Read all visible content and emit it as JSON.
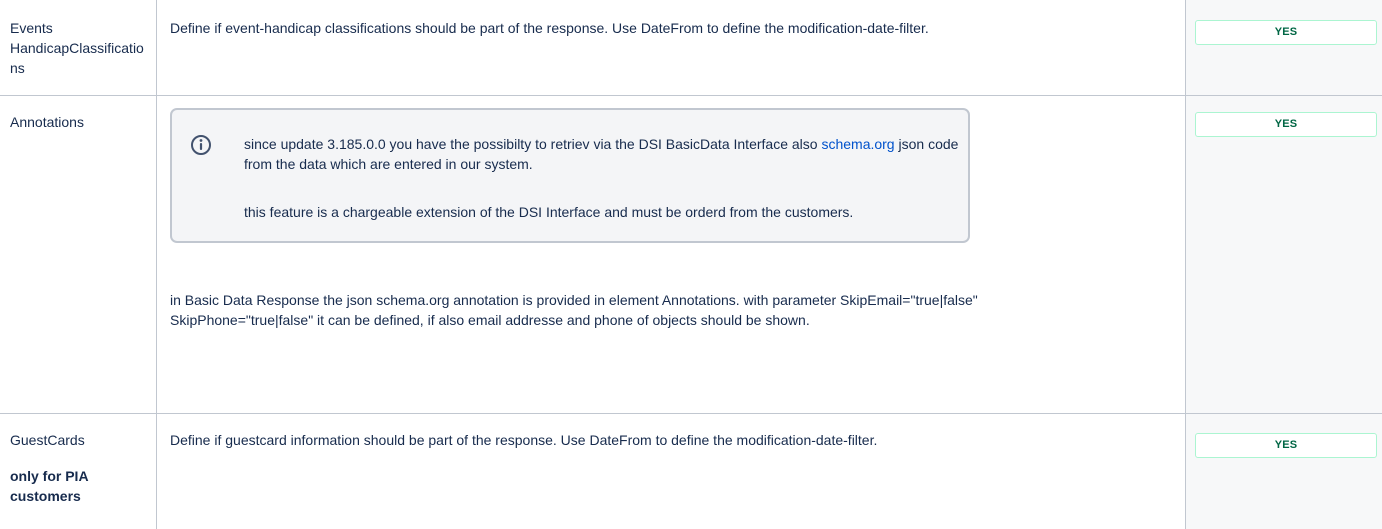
{
  "rows": [
    {
      "name": "Events HandicapClassifications",
      "description": "Define if event-handicap classifications should be part of the response. Use DateFrom to define the modification-date-filter.",
      "status": "YES"
    },
    {
      "name": "Annotations",
      "info_panel": {
        "icon": "info-icon",
        "text_before_link": "since update 3.185.0.0 you have the possibilty to retriev via the DSI BasicData Interface also ",
        "link_text": "schema.org",
        "text_after_link": " json code from the data which are entered in our system.",
        "second_paragraph": "this feature is a chargeable extension of the DSI Interface and must be orderd from the customers."
      },
      "description": "in Basic Data Response the json schema.org annotation is provided in element Annotations. with parameter SkipEmail=\"true|false\" SkipPhone=\"true|false\" it can be defined, if also email addresse and phone of objects should be shown.",
      "status": "YES"
    },
    {
      "name": "GuestCards",
      "note": "only for PIA customers",
      "description": "Define if guestcard information should be part of the response. Use DateFrom to define the modification-date-filter.",
      "status": "YES"
    }
  ],
  "colors": {
    "border": "#c1c7d0",
    "status_text": "#006644",
    "status_border": "#abf5d1",
    "link": "#0052cc",
    "panel_bg": "#f4f5f7"
  }
}
